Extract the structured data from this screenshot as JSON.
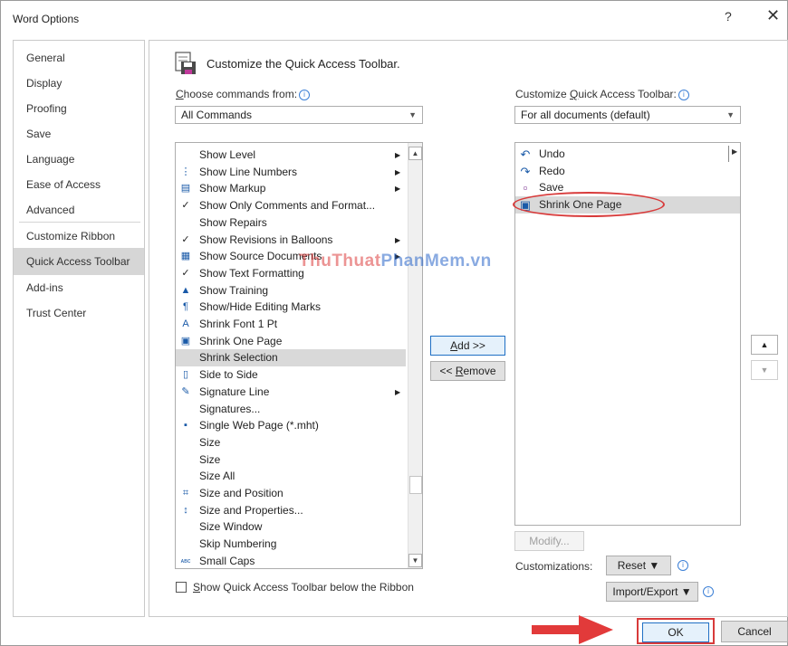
{
  "dialog": {
    "title": "Word Options",
    "help": "?",
    "close": "✕"
  },
  "nav": {
    "items": [
      "General",
      "Display",
      "Proofing",
      "Save",
      "Language",
      "Ease of Access",
      "Advanced",
      "Customize Ribbon",
      "Quick Access Toolbar",
      "Add-ins",
      "Trust Center"
    ],
    "active": "Quick Access Toolbar"
  },
  "heading": "Customize the Quick Access Toolbar.",
  "left": {
    "label_prefix": "C",
    "label_rest": "hoose commands from:",
    "combo_value": "All Commands",
    "commands": [
      {
        "label": "Show Level",
        "icon": "",
        "submenu": true
      },
      {
        "label": "Show Line Numbers",
        "icon": "line-numbers",
        "submenu": true
      },
      {
        "label": "Show Markup",
        "icon": "markup",
        "submenu": true
      },
      {
        "label": "Show Only Comments and Format...",
        "icon": "check",
        "submenu": false
      },
      {
        "label": "Show Repairs",
        "icon": "",
        "submenu": false
      },
      {
        "label": "Show Revisions in Balloons",
        "icon": "check",
        "submenu": true
      },
      {
        "label": "Show Source Documents",
        "icon": "source-documents",
        "submenu": true
      },
      {
        "label": "Show Text Formatting",
        "icon": "check",
        "submenu": false
      },
      {
        "label": "Show Training",
        "icon": "graduation-cap",
        "submenu": false
      },
      {
        "label": "Show/Hide Editing Marks",
        "icon": "pilcrow",
        "submenu": false
      },
      {
        "label": "Shrink Font 1 Pt",
        "icon": "shrink-font",
        "submenu": false
      },
      {
        "label": "Shrink One Page",
        "icon": "shrink-page",
        "submenu": false
      },
      {
        "label": "Shrink Selection",
        "icon": "",
        "submenu": false
      },
      {
        "label": "Side to Side",
        "icon": "side-by-side",
        "submenu": false
      },
      {
        "label": "Signature Line",
        "icon": "signature",
        "submenu": true
      },
      {
        "label": "Signatures...",
        "icon": "",
        "submenu": false
      },
      {
        "label": "Single Web Page (*.mht)",
        "icon": "save-web",
        "submenu": false
      },
      {
        "label": "Size",
        "icon": "",
        "submenu": false
      },
      {
        "label": "Size",
        "icon": "",
        "submenu": false
      },
      {
        "label": "Size All",
        "icon": "",
        "submenu": false
      },
      {
        "label": "Size and Position",
        "icon": "size-position",
        "submenu": false
      },
      {
        "label": "Size and Properties...",
        "icon": "size-properties",
        "submenu": false
      },
      {
        "label": "Size Window",
        "icon": "",
        "submenu": false
      },
      {
        "label": "Skip Numbering",
        "icon": "",
        "submenu": false
      },
      {
        "label": "Small Caps",
        "icon": "small-caps",
        "submenu": false
      }
    ],
    "selected": "Shrink Selection",
    "checkbox_prefix": "S",
    "checkbox_rest": "how Quick Access Toolbar below the Ribbon",
    "checkbox_checked": false
  },
  "middle": {
    "add": "Add >>",
    "add_u": "A",
    "remove_prefix": "<< ",
    "remove_u": "R",
    "remove_rest": "emove"
  },
  "right": {
    "label_pre": "Customize ",
    "label_u": "Q",
    "label_rest": "uick Access Toolbar:",
    "combo_value": "For all documents (default)",
    "items": [
      {
        "label": "Undo",
        "icon": "undo"
      },
      {
        "label": "Redo",
        "icon": "redo"
      },
      {
        "label": "Save",
        "icon": "save"
      },
      {
        "label": "Shrink One Page",
        "icon": "shrink-page"
      }
    ],
    "selected": "Shrink One Page",
    "modify": "Modify...",
    "customizations_label": "Customizations:",
    "reset": "Reset ▼",
    "import_export": "Import/Export ▼"
  },
  "footer": {
    "ok": "OK",
    "cancel": "Cancel"
  },
  "watermark": {
    "part1": "ThuThuat",
    "part2": "PhanMem.vn"
  },
  "colors": {
    "accent": "#1f6fc4",
    "highlight": "#d83b3b",
    "selection": "#d9d9d9"
  }
}
